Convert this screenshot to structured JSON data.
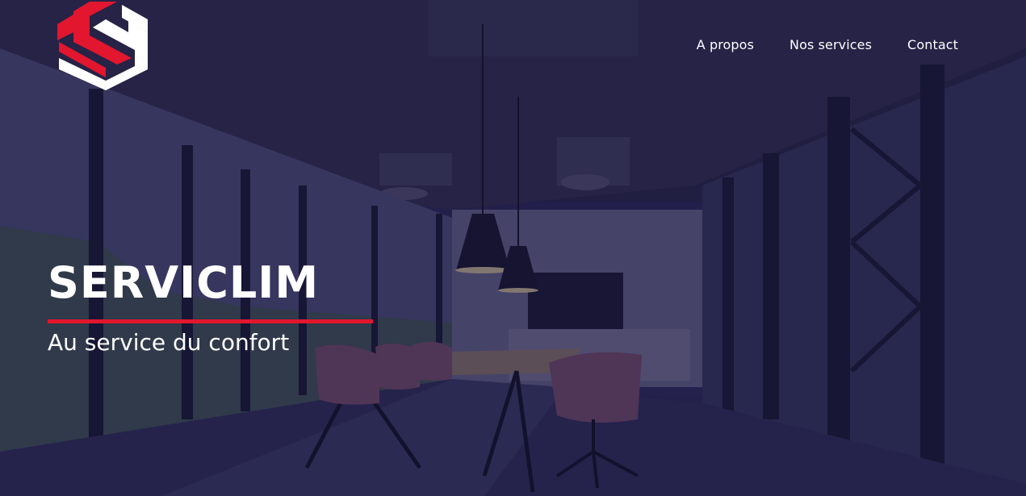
{
  "brand": {
    "logo_icon": "serviclim-s-logo",
    "accent_color": "#e2162e"
  },
  "nav": {
    "items": [
      {
        "label": "A propos"
      },
      {
        "label": "Nos services"
      },
      {
        "label": "Contact"
      }
    ]
  },
  "hero": {
    "title": "SERVICLIM",
    "subtitle": "Au service du confort",
    "overlay_color": "#1c1a46"
  }
}
